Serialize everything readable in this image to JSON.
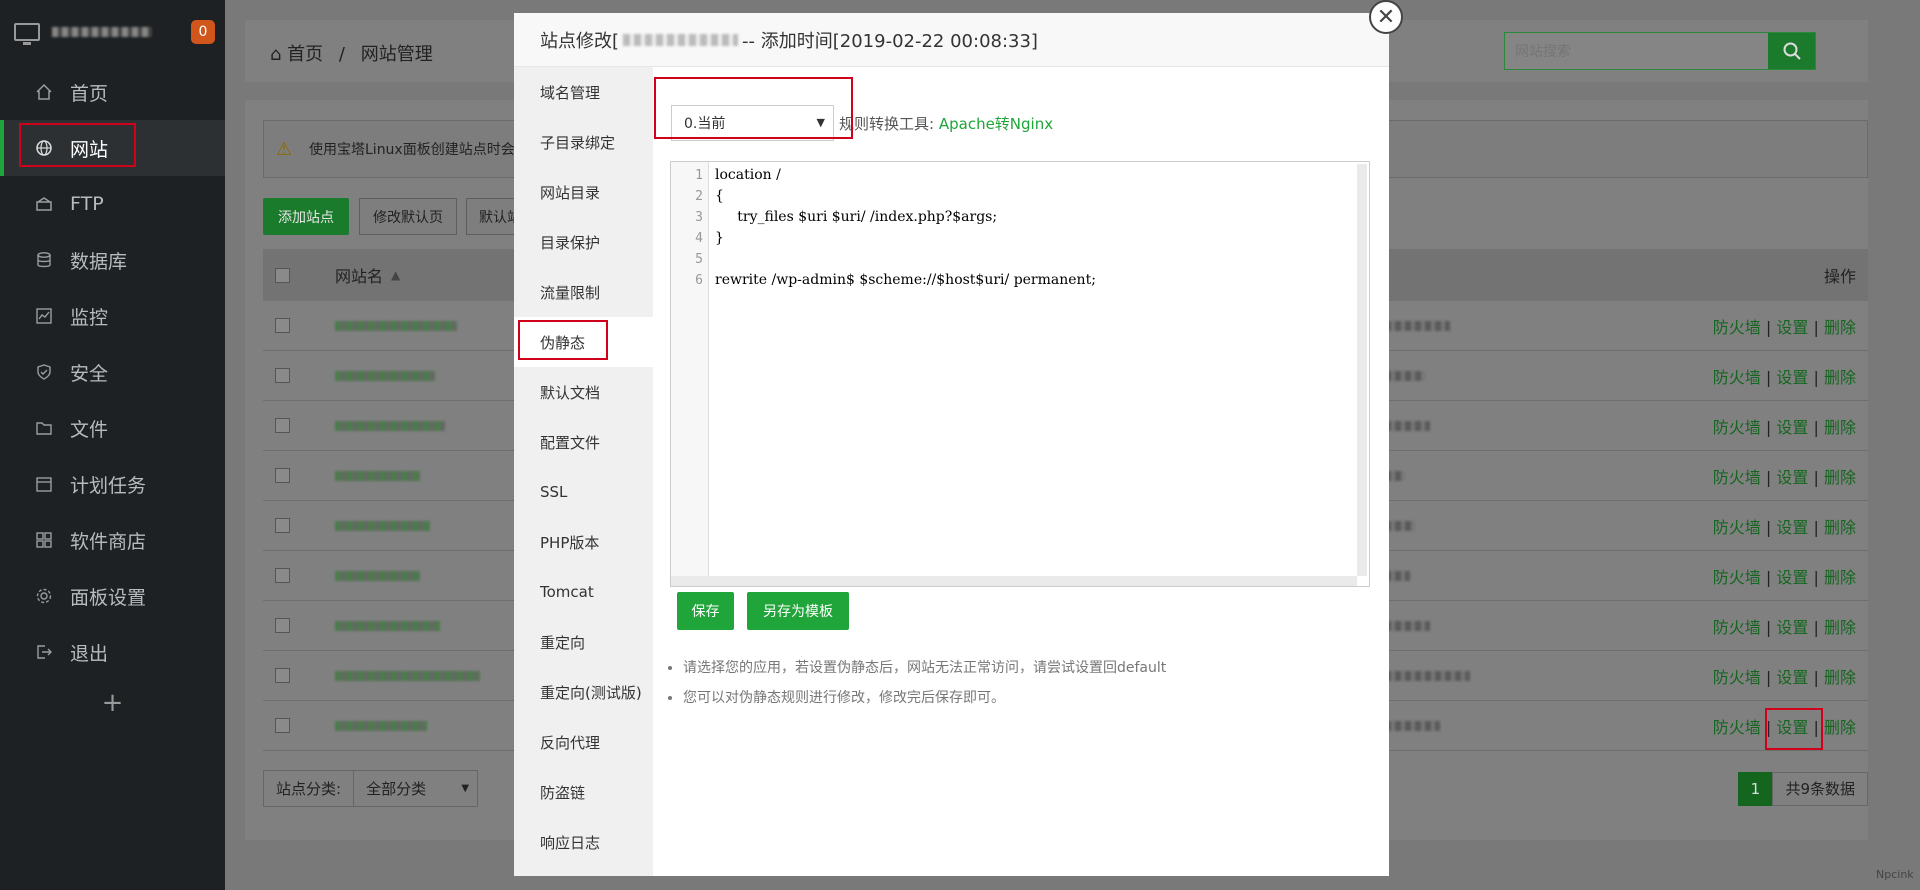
{
  "sidebar": {
    "badge": "0",
    "items": [
      {
        "label": "首页",
        "icon": "home-icon"
      },
      {
        "label": "网站",
        "icon": "globe-icon"
      },
      {
        "label": "FTP",
        "icon": "ftp-icon"
      },
      {
        "label": "数据库",
        "icon": "database-icon"
      },
      {
        "label": "监控",
        "icon": "monitor-icon"
      },
      {
        "label": "安全",
        "icon": "shield-icon"
      },
      {
        "label": "文件",
        "icon": "folder-icon"
      },
      {
        "label": "计划任务",
        "icon": "calendar-icon"
      },
      {
        "label": "软件商店",
        "icon": "grid-icon"
      },
      {
        "label": "面板设置",
        "icon": "gear-icon"
      },
      {
        "label": "退出",
        "icon": "logout-icon"
      }
    ],
    "add": "+"
  },
  "breadcrumb": {
    "home": "首页",
    "sep": "/",
    "current": "网站管理"
  },
  "search": {
    "placeholder": "网站搜索"
  },
  "warning": {
    "text": "使用宝塔Linux面板创建站点时会"
  },
  "toolbar": {
    "add_site": "添加站点",
    "modify_default": "修改默认页",
    "default_partial": "默认站"
  },
  "table": {
    "col_name": "网站名",
    "col_ops": "操作",
    "ops": {
      "firewall": "防火墙",
      "sep": "|",
      "settings": "设置",
      "delete": "删除"
    },
    "row_count": 9
  },
  "footer": {
    "category_label": "站点分类:",
    "category_value": "全部分类",
    "page": "1",
    "total": "共9条数据"
  },
  "modal": {
    "title_prefix": "站点修改[",
    "title_suffix": "-- 添加时间[2019-02-22 00:08:33]",
    "menu": [
      "域名管理",
      "子目录绑定",
      "网站目录",
      "目录保护",
      "流量限制",
      "伪静态",
      "默认文档",
      "配置文件",
      "SSL",
      "PHP版本",
      "Tomcat",
      "重定向",
      "重定向(测试版)",
      "反向代理",
      "防盗链",
      "响应日志"
    ],
    "selected_menu": "伪静态",
    "select_value": "0.当前",
    "rule_label": "规则转换工具:",
    "rule_link": "Apache转Nginx",
    "code": [
      {
        "n": "1",
        "text": "location /"
      },
      {
        "n": "2",
        "text": "{"
      },
      {
        "n": "3",
        "text": "     try_files $uri $uri/ /index.php?$args;"
      },
      {
        "n": "4",
        "text": "}"
      },
      {
        "n": "5",
        "text": ""
      },
      {
        "n": "6",
        "text": "rewrite /wp-admin$ $scheme://$host$uri/ permanent;"
      }
    ],
    "save": "保存",
    "save_template": "另存为模板",
    "tips": [
      "请选择您的应用，若设置伪静态后，网站无法正常访问，请尝试设置回default",
      "您可以对伪静态规则进行修改，修改完后保存即可。"
    ]
  },
  "watermark": "Npcink"
}
